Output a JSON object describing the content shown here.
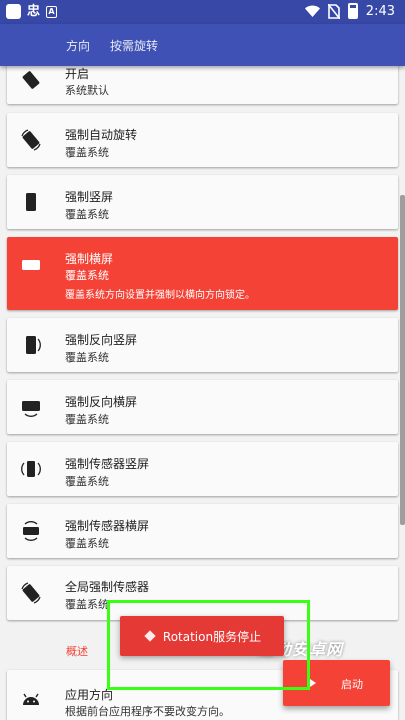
{
  "status_bar": {
    "time": "2:43",
    "left_glyph": "忠",
    "left_badge": "A",
    "icons": [
      "app-square-icon",
      "notification-glyph-icon",
      "a-badge-icon",
      "wifi-icon",
      "no-sim-icon",
      "battery-icon"
    ]
  },
  "tabs": [
    {
      "label": "方向"
    },
    {
      "label": "按需旋转"
    }
  ],
  "options": [
    {
      "title": "开启",
      "sub": "系统默认",
      "icon": "rotation-auto-icon"
    },
    {
      "title": "强制自动旋转",
      "sub": "覆盖系统",
      "icon": "rotation-auto-icon"
    },
    {
      "title": "强制竖屏",
      "sub": "覆盖系统",
      "icon": "portrait-icon"
    },
    {
      "title": "强制横屏",
      "sub": "覆盖系统",
      "desc": "覆盖系统方向设置并强制以横向方向锁定。",
      "icon": "landscape-icon",
      "active": true
    },
    {
      "title": "强制反向竖屏",
      "sub": "覆盖系统",
      "icon": "reverse-portrait-icon"
    },
    {
      "title": "强制反向横屏",
      "sub": "覆盖系统",
      "icon": "reverse-landscape-icon"
    },
    {
      "title": "强制传感器竖屏",
      "sub": "覆盖系统",
      "icon": "sensor-portrait-icon"
    },
    {
      "title": "强制传感器横屏",
      "sub": "覆盖系统",
      "icon": "sensor-landscape-icon"
    },
    {
      "title": "全局强制传感器",
      "sub": "覆盖系统",
      "icon": "global-sensor-icon"
    }
  ],
  "section": {
    "label": "概述"
  },
  "app_orientation": {
    "title": "应用方向",
    "sub": "根据前台应用程序不要改变方向。",
    "icon": "android-icon"
  },
  "toast": {
    "text": "Rotation服务停止",
    "icon": "rotation-diamond-icon"
  },
  "fab": {
    "label": "启动",
    "icon": "play-icon"
  },
  "watermark": {
    "text": "趣动安卓网"
  },
  "colors": {
    "primary": "#3f51b5",
    "status_bar": "#3848a6",
    "accent": "#f44336",
    "highlight": "#39ff14"
  }
}
